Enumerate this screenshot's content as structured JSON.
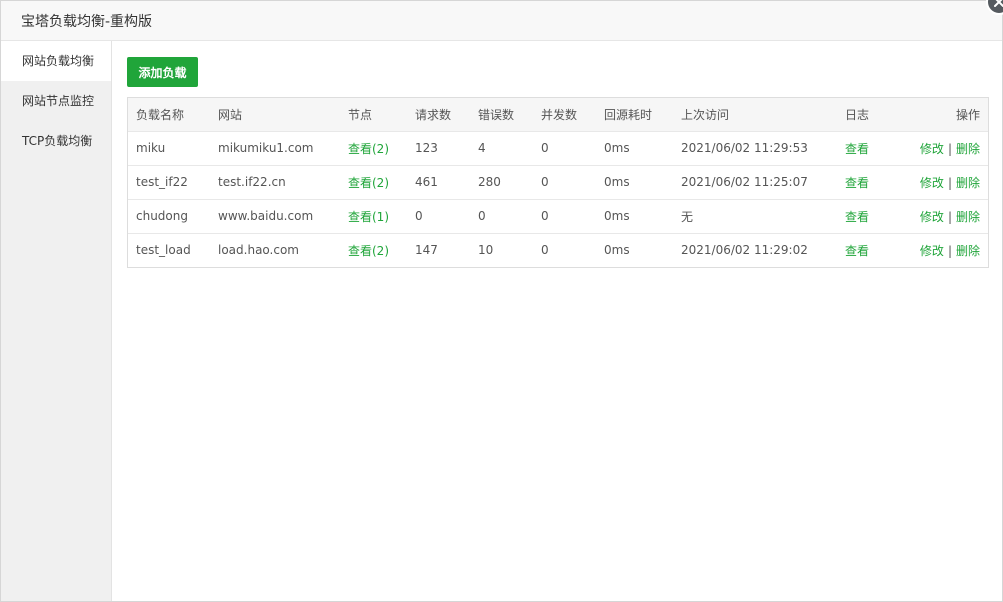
{
  "window": {
    "title": "宝塔负载均衡-重构版"
  },
  "sidebar": {
    "items": [
      {
        "label": "网站负载均衡",
        "active": true
      },
      {
        "label": "网站节点监控",
        "active": false
      },
      {
        "label": "TCP负载均衡",
        "active": false
      }
    ]
  },
  "toolbar": {
    "add_label": "添加负载"
  },
  "table": {
    "headers": {
      "name": "负载名称",
      "site": "网站",
      "nodes": "节点",
      "requests": "请求数",
      "errors": "错误数",
      "concurrency": "并发数",
      "latency": "回源耗时",
      "last_visit": "上次访问",
      "log": "日志",
      "actions": "操作"
    },
    "rows": [
      {
        "name": "miku",
        "site": "mikumiku1.com",
        "nodes": "查看(2)",
        "requests": "123",
        "errors": "4",
        "concurrency": "0",
        "latency": "0ms",
        "last_visit": "2021/06/02 11:29:53",
        "log": "查看",
        "edit": "修改",
        "sep": "|",
        "delete": "删除"
      },
      {
        "name": "test_if22",
        "site": "test.if22.cn",
        "nodes": "查看(2)",
        "requests": "461",
        "errors": "280",
        "concurrency": "0",
        "latency": "0ms",
        "last_visit": "2021/06/02 11:25:07",
        "log": "查看",
        "edit": "修改",
        "sep": "|",
        "delete": "删除"
      },
      {
        "name": "chudong",
        "site": "www.baidu.com",
        "nodes": "查看(1)",
        "requests": "0",
        "errors": "0",
        "concurrency": "0",
        "latency": "0ms",
        "last_visit": "无",
        "log": "查看",
        "edit": "修改",
        "sep": "|",
        "delete": "删除"
      },
      {
        "name": "test_load",
        "site": "load.hao.com",
        "nodes": "查看(2)",
        "requests": "147",
        "errors": "10",
        "concurrency": "0",
        "latency": "0ms",
        "last_visit": "2021/06/02 11:29:02",
        "log": "查看",
        "edit": "修改",
        "sep": "|",
        "delete": "删除"
      }
    ]
  },
  "colors": {
    "accent": "#20a53a",
    "sidebar_bg": "#f0f0f0",
    "header_bg": "#f6f6f6"
  },
  "icons": {
    "close": "close-icon"
  }
}
